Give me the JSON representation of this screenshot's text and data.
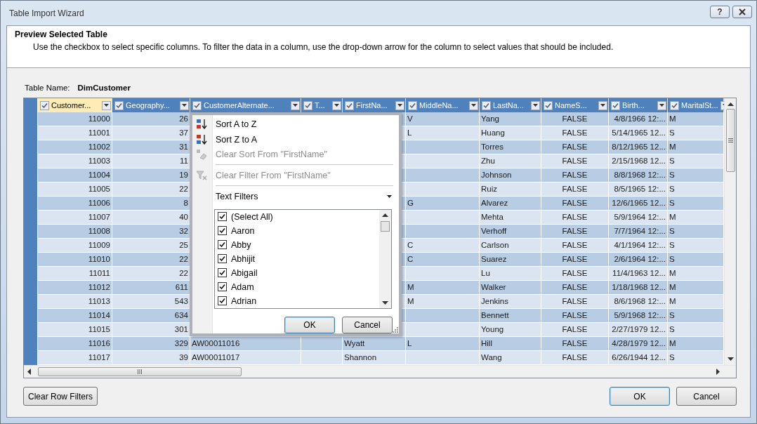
{
  "window": {
    "title": "Table Import Wizard",
    "help_button": "?"
  },
  "header": {
    "title": "Preview Selected Table",
    "description": "Use the checkbox to select specific columns. To filter the data in a column, use the drop-down arrow  for the column to select values that should be included."
  },
  "table_name": {
    "label": "Table Name:",
    "value": "DimCustomer"
  },
  "table": {
    "columns": [
      {
        "label": "Customer...",
        "checked": true,
        "selected": true
      },
      {
        "label": "Geography...",
        "checked": true,
        "selected": false
      },
      {
        "label": "CustomerAlternate...",
        "checked": true,
        "selected": false
      },
      {
        "label": "T...",
        "checked": true,
        "selected": false
      },
      {
        "label": "FirstNa...",
        "checked": true,
        "selected": false
      },
      {
        "label": "MiddleNa...",
        "checked": true,
        "selected": false
      },
      {
        "label": "LastNa...",
        "checked": true,
        "selected": false
      },
      {
        "label": "NameS...",
        "checked": true,
        "selected": false
      },
      {
        "label": "Birth...",
        "checked": true,
        "selected": false
      },
      {
        "label": "MaritalSt...",
        "checked": true,
        "selected": false
      }
    ],
    "rows": [
      [
        "11000",
        "26",
        null,
        null,
        null,
        "V",
        "Yang",
        "FALSE",
        "4/8/1966 12:...",
        "M"
      ],
      [
        "11001",
        "37",
        null,
        null,
        null,
        "L",
        "Huang",
        "FALSE",
        "5/14/1965 12...",
        "S"
      ],
      [
        "11002",
        "31",
        null,
        null,
        null,
        null,
        "Torres",
        "FALSE",
        "8/12/1965 12...",
        "M"
      ],
      [
        "11003",
        "11",
        null,
        null,
        null,
        null,
        "Zhu",
        "FALSE",
        "2/15/1968 12...",
        "S"
      ],
      [
        "11004",
        "19",
        null,
        null,
        null,
        null,
        "Johnson",
        "FALSE",
        "8/8/1968 12:...",
        "S"
      ],
      [
        "11005",
        "22",
        null,
        null,
        null,
        null,
        "Ruiz",
        "FALSE",
        "8/5/1965 12:...",
        "S"
      ],
      [
        "11006",
        "8",
        null,
        null,
        null,
        "G",
        "Alvarez",
        "FALSE",
        "12/6/1965 12...",
        "S"
      ],
      [
        "11007",
        "40",
        null,
        null,
        null,
        null,
        "Mehta",
        "FALSE",
        "5/9/1964 12:...",
        "M"
      ],
      [
        "11008",
        "32",
        null,
        null,
        null,
        null,
        "Verhoff",
        "FALSE",
        "7/7/1964 12:...",
        "S"
      ],
      [
        "11009",
        "25",
        null,
        null,
        null,
        "C",
        "Carlson",
        "FALSE",
        "4/1/1964 12:...",
        "S"
      ],
      [
        "11010",
        "22",
        null,
        null,
        null,
        "C",
        "Suarez",
        "FALSE",
        "2/6/1964 12:...",
        "S"
      ],
      [
        "11011",
        "22",
        null,
        null,
        null,
        null,
        "Lu",
        "FALSE",
        "11/4/1963 12...",
        "M"
      ],
      [
        "11012",
        "611",
        null,
        null,
        null,
        "M",
        "Walker",
        "FALSE",
        "1/18/1968 12...",
        "M"
      ],
      [
        "11013",
        "543",
        null,
        null,
        null,
        "M",
        "Jenkins",
        "FALSE",
        "8/6/1968 12:...",
        "M"
      ],
      [
        "11014",
        "634",
        null,
        null,
        null,
        null,
        "Bennett",
        "FALSE",
        "5/9/1968 12:...",
        "S"
      ],
      [
        "11015",
        "301",
        null,
        null,
        null,
        null,
        "Young",
        "FALSE",
        "2/27/1979 12...",
        "S"
      ],
      [
        "11016",
        "329",
        "AW00011016",
        null,
        "Wyatt",
        "L",
        "Hill",
        "FALSE",
        "4/28/1979 12...",
        "M"
      ],
      [
        "11017",
        "39",
        "AW00011017",
        null,
        "Shannon",
        null,
        "Wang",
        "FALSE",
        "6/26/1944 12...",
        "S"
      ]
    ]
  },
  "filter_popup": {
    "menu": [
      {
        "kind": "sort_asc",
        "label": "Sort A to Z",
        "disabled": false
      },
      {
        "kind": "sort_desc",
        "label": "Sort Z to A",
        "disabled": false
      },
      {
        "kind": "clear_sort",
        "label": "Clear Sort From \"FirstName\"",
        "disabled": true
      },
      {
        "kind": "clear_filter",
        "label": "Clear Filter From \"FirstName\"",
        "disabled": true
      },
      {
        "kind": "submenu",
        "label": "Text Filters",
        "disabled": false
      }
    ],
    "values": [
      {
        "label": "(Select All)",
        "checked": true
      },
      {
        "label": "Aaron",
        "checked": true
      },
      {
        "label": "Abby",
        "checked": true
      },
      {
        "label": "Abhijit",
        "checked": true
      },
      {
        "label": "Abigail",
        "checked": true
      },
      {
        "label": "Adam",
        "checked": true
      },
      {
        "label": "Adrian",
        "checked": true
      }
    ],
    "buttons": [
      {
        "label": "OK",
        "default": true
      },
      {
        "label": "Cancel",
        "default": false
      }
    ]
  },
  "footer": {
    "clear_button": "Clear Row Filters",
    "buttons": [
      {
        "label": "OK",
        "default": true
      },
      {
        "label": "Cancel",
        "default": false
      }
    ]
  }
}
